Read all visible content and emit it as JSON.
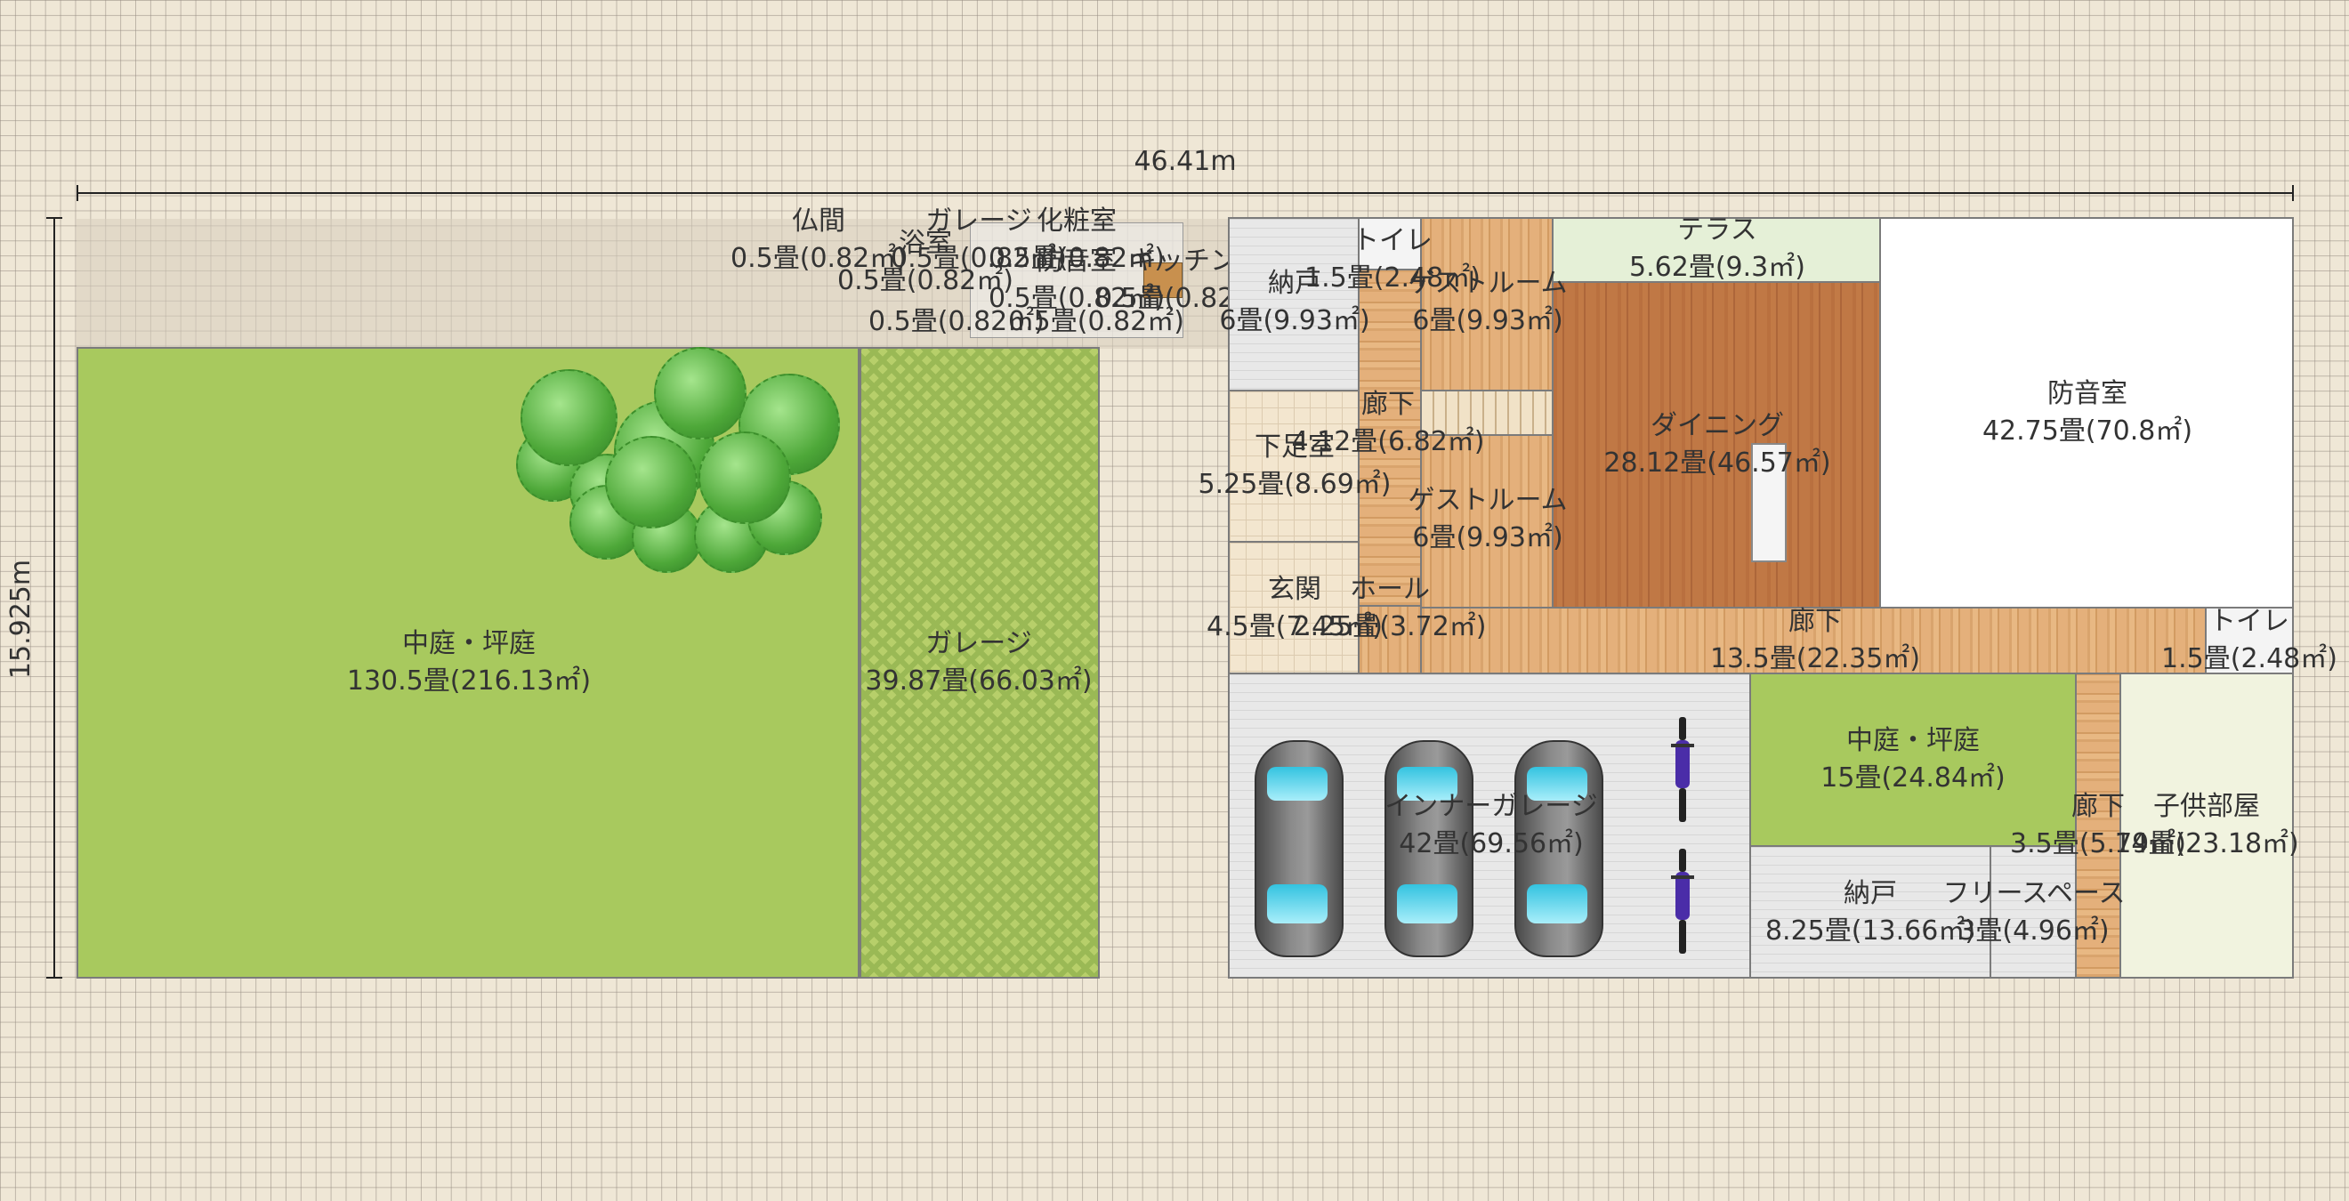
{
  "dimensions": {
    "width_label": "46.41m",
    "height_label": "15.925m"
  },
  "rooms": {
    "courtyard_main": {
      "name": "中庭・坪庭",
      "area": "130.5畳(216.13㎡)"
    },
    "garage_outer": {
      "name": "ガレージ",
      "area": "39.87畳(66.03㎡)"
    },
    "butsuma": {
      "name": "仏間",
      "area": "0.5畳(0.82㎡)"
    },
    "garage_small": {
      "name": "ガレージ",
      "area": "0.5畳(0.82㎡)"
    },
    "keshoushitsu": {
      "name": "化粧室",
      "area": "0.5畳(0.82㎡)"
    },
    "bath": {
      "name": "浴室",
      "area": "0.5畳(0.82㎡)"
    },
    "soundproof_small": {
      "name": "防音室",
      "area": "0.5畳(0.82㎡)"
    },
    "kitchen": {
      "name": "キッチン",
      "area": "0.5畳(0.82㎡)"
    },
    "small_a": {
      "area": "0.5畳(0.82㎡)"
    },
    "small_b": {
      "area": "0.5畳(0.82㎡)"
    },
    "toilet_top": {
      "name": "トイレ",
      "area": "1.5畳(2.48㎡)"
    },
    "storage_top": {
      "name": "納戸",
      "area": "6畳(9.93㎡)"
    },
    "guest_top": {
      "name": "ゲストルーム",
      "area": "6畳(9.93㎡)"
    },
    "terrace": {
      "name": "テラス",
      "area": "5.62畳(9.3㎡)"
    },
    "soundproof_big": {
      "name": "防音室",
      "area": "42.75畳(70.8㎡)"
    },
    "dining": {
      "name": "ダイニング",
      "area": "28.12畳(46.57㎡)"
    },
    "corridor_mid": {
      "name": "廊下",
      "area": "4.12畳(6.82㎡)"
    },
    "shoe_room": {
      "name": "下足室",
      "area": "5.25畳(8.69㎡)"
    },
    "guest_mid": {
      "name": "ゲストルーム",
      "area": "6畳(9.93㎡)"
    },
    "entrance": {
      "name": "玄関",
      "area": "4.5畳(7.45㎡)"
    },
    "hall": {
      "name": "ホール",
      "area": "2.25畳(3.72㎡)"
    },
    "corridor_long": {
      "name": "廊下",
      "area": "13.5畳(22.35㎡)"
    },
    "toilet_right": {
      "name": "トイレ",
      "area": "1.5畳(2.48㎡)"
    },
    "inner_garage": {
      "name": "インナーガレージ",
      "area": "42畳(69.56㎡)"
    },
    "courtyard_small": {
      "name": "中庭・坪庭",
      "area": "15畳(24.84㎡)"
    },
    "corridor_right": {
      "name": "廊下",
      "area": "3.5畳(5.79㎡)"
    },
    "kids_room": {
      "name": "子供部屋",
      "area": "14畳(23.18㎡)"
    },
    "storage_bottom": {
      "name": "納戸",
      "area": "8.25畳(13.66㎡)"
    },
    "free_space": {
      "name": "フリースペース",
      "area": "3畳(4.96㎡)"
    }
  },
  "colors": {
    "lawn": "#a8c95e",
    "background": "#efe7d6",
    "terrace": "#e5f0d7",
    "kids_room": "#f1f3df"
  }
}
